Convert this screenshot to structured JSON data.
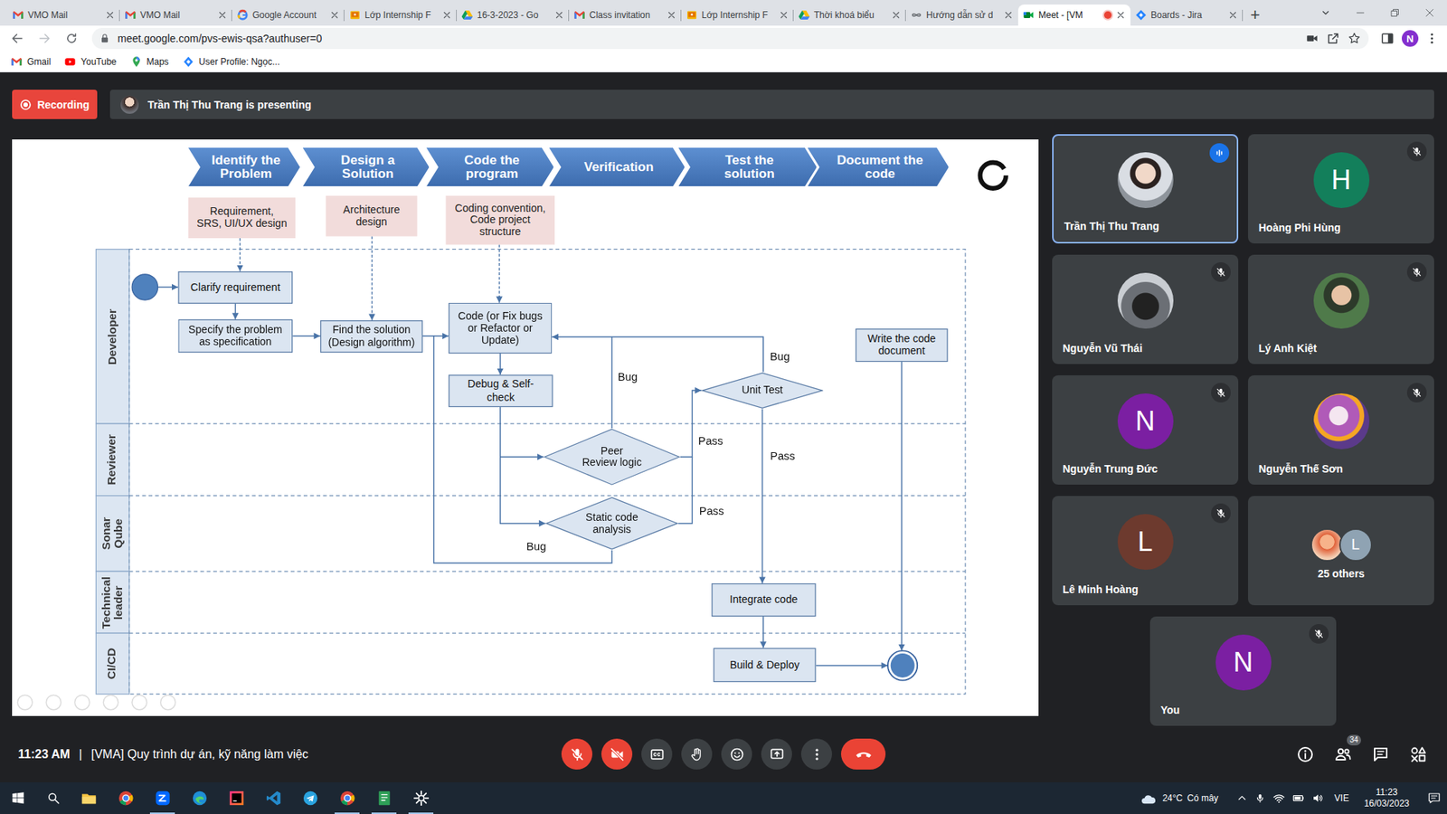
{
  "browser": {
    "tabs": [
      {
        "label": "VMO Mail",
        "selected": false,
        "recording": false
      },
      {
        "label": "VMO Mail",
        "selected": false,
        "recording": false
      },
      {
        "label": "Google Account",
        "selected": false,
        "recording": false
      },
      {
        "label": "Lớp Internship F",
        "selected": false,
        "recording": false
      },
      {
        "label": "16-3-2023 - Go",
        "selected": false,
        "recording": false
      },
      {
        "label": "Class invitation",
        "selected": false,
        "recording": false
      },
      {
        "label": "Lớp Internship F",
        "selected": false,
        "recording": false
      },
      {
        "label": "Thời khoá biểu",
        "selected": false,
        "recording": false
      },
      {
        "label": "Hướng dẫn sử d",
        "selected": false,
        "recording": false
      },
      {
        "label": "Meet - [VM",
        "selected": true,
        "recording": true
      },
      {
        "label": "Boards - Jira",
        "selected": false,
        "recording": false
      }
    ],
    "new_tab": "+",
    "address": "meet.google.com/pvs-ewis-qsa?authuser=0",
    "profile_initial": "N",
    "bookmarks": [
      "Gmail",
      "YouTube",
      "Maps",
      "User Profile: Ngọc..."
    ]
  },
  "meet": {
    "recording": "Recording",
    "presenter_banner": "Trần Thị Thu Trang is presenting",
    "slide": {
      "phases": [
        "Identify the\nProblem",
        "Design a\nSolution",
        "Code the\nprogram",
        "Verification",
        "Test the\nsolution",
        "Document the\ncode"
      ],
      "notes": [
        "Requirement,\nSRS, UI/UX design",
        "Architecture\ndesign",
        "Coding convention,\nCode project\nstructure"
      ],
      "lanes": [
        "Developer",
        "Reviewer",
        "Sonar\nQube",
        "Technical\nleader",
        "CI/CD"
      ],
      "nodes": [
        {
          "text": "Clarify requirement",
          "kind": "box"
        },
        {
          "text": "Specify the problem\nas specification",
          "kind": "box"
        },
        {
          "text": "Find the solution\n(Design algorithm)",
          "kind": "box"
        },
        {
          "text": "Code (or Fix bugs\nor Refactor or\nUpdate)",
          "kind": "box"
        },
        {
          "text": "Debug & Self-\ncheck",
          "kind": "box"
        },
        {
          "text": "Peer\nReview logic",
          "kind": "diamond"
        },
        {
          "text": "Static code\nanalysis",
          "kind": "diamond"
        },
        {
          "text": "Unit Test",
          "kind": "diamond"
        },
        {
          "text": "Write the code\ndocument",
          "kind": "box"
        },
        {
          "text": "Integrate code",
          "kind": "box"
        },
        {
          "text": "Build & Deploy",
          "kind": "box"
        }
      ],
      "edge_labels": [
        "Bug",
        "Bug",
        "Pass",
        "Pass",
        "Pass",
        "Bug"
      ]
    },
    "participants": [
      {
        "name": "Trần Thị Thu Trang",
        "kind": "photo",
        "muted": false,
        "speaking": true
      },
      {
        "name": "Hoàng Phi Hùng",
        "kind": "initial",
        "initial": "H",
        "color": "#137f5b",
        "muted": true,
        "speaking": false
      },
      {
        "name": "Nguyễn Vũ Thái",
        "kind": "photo",
        "muted": true,
        "speaking": false
      },
      {
        "name": "Lý Anh Kiệt",
        "kind": "photo",
        "muted": true,
        "speaking": false
      },
      {
        "name": "Nguyễn Trung Đức",
        "kind": "initial",
        "initial": "N",
        "color": "#7b1fa2",
        "muted": true,
        "speaking": false
      },
      {
        "name": "Nguyễn Thế Sơn",
        "kind": "photo",
        "muted": true,
        "speaking": false
      },
      {
        "name": "Lê Minh Hoàng",
        "kind": "initial",
        "initial": "L",
        "color": "#6d3a2e",
        "muted": true,
        "speaking": false
      },
      {
        "name": "25 others",
        "kind": "group",
        "initial": "L",
        "color": "#8fa3b3",
        "muted": false,
        "speaking": false
      },
      {
        "name": "You",
        "kind": "initial",
        "initial": "N",
        "color": "#7b1fa2",
        "muted": true,
        "speaking": false
      }
    ],
    "time": "11:23 AM",
    "separator": "|",
    "meeting_title": "[VMA] Quy trình dự án, kỹ năng làm việc",
    "mic_on": false,
    "camera_on": false,
    "people_count": "34"
  },
  "taskbar": {
    "apps": [
      {
        "running": false
      },
      {
        "running": false
      },
      {
        "running": true
      },
      {
        "running": false
      },
      {
        "running": false
      },
      {
        "running": false
      },
      {
        "running": false
      },
      {
        "running": true
      },
      {
        "running": true
      },
      {
        "running": true
      }
    ],
    "weather_temp": "24°C",
    "weather_text": "Có mây",
    "language": "VIE",
    "time": "11:23",
    "date": "16/03/2023"
  }
}
